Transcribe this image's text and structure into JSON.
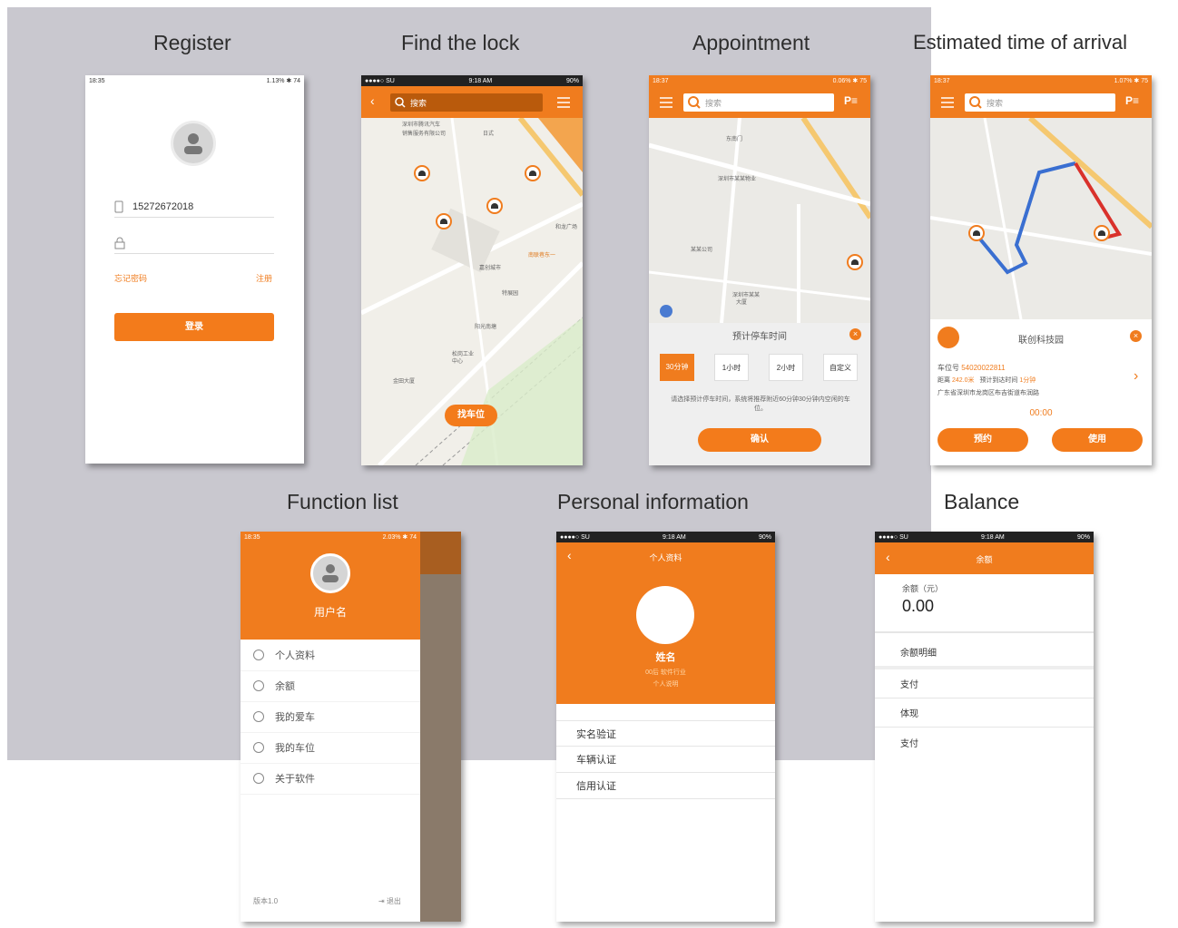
{
  "titles": {
    "register": "Register",
    "find_lock": "Find the lock",
    "appointment": "Appointment",
    "eta": "Estimated time of arrival",
    "function_list": "Function list",
    "personal_info": "Personal information",
    "balance": "Balance"
  },
  "register": {
    "status_time": "18:35",
    "status_right": "1.13% ✱ 74",
    "phone_value": "15272672018",
    "password_value": "",
    "forgot_label": "忘记密码",
    "register_link": "注册",
    "login_button": "登录"
  },
  "find_lock": {
    "status_left": "●●●●○ SU",
    "status_time": "9:18 AM",
    "status_right": "90%",
    "search_placeholder": "搜索",
    "find_button": "找车位",
    "map_labels": [
      "深圳市腾讯汽车",
      "销售服务有限公司",
      "日式",
      "和龙广场",
      "南联巷东一",
      "嘉创城市",
      "特展园",
      "阳光南塘",
      "松岗工业",
      "中心",
      "金田大厦"
    ]
  },
  "appointment": {
    "status_time": "18:37",
    "status_right": "0.06% ✱ 75",
    "search_placeholder": "搜索",
    "panel_title": "预计停车时间",
    "options": [
      "30分钟",
      "1小时",
      "2小时",
      "自定义"
    ],
    "hint": "请选择预计停车时间，系统将推荐附近60分钟30分钟内空闲的车位。",
    "confirm_button": "确认",
    "map_labels": [
      "东南门",
      "深圳市某某",
      "大厦",
      "深圳市某某物业",
      "某某公司"
    ]
  },
  "eta": {
    "status_time": "18:37",
    "status_right": "1.07% ✱ 75",
    "search_placeholder": "搜索",
    "place_name": "联创科技园",
    "spot_label": "车位号",
    "spot_number": "54020022811",
    "distance_label": "距离",
    "distance_value": "242.0米",
    "arrival_label": "预计到达时间",
    "arrival_value": "1分钟",
    "address": "广东省深圳市龙岗区布吉街道布润路",
    "timer": "00:00",
    "reserve_button": "预约",
    "use_button": "使用"
  },
  "function_list": {
    "status_time": "18:35",
    "status_right": "2.03% ✱ 74",
    "username": "用户名",
    "items": [
      {
        "label": "个人资料",
        "icon": "user-icon"
      },
      {
        "label": "余额",
        "icon": "wallet-icon"
      },
      {
        "label": "我的爱车",
        "icon": "car-icon"
      },
      {
        "label": "我的车位",
        "icon": "parking-icon"
      },
      {
        "label": "关于软件",
        "icon": "info-icon"
      }
    ],
    "version": "版本1.0",
    "logout": "退出"
  },
  "personal_info": {
    "status_left": "●●●●○ SU",
    "status_time": "9:18 AM",
    "status_right": "90%",
    "title": "个人资料",
    "name": "姓名",
    "sub1": "00后 软件行业",
    "sub2": "个人说明",
    "rows": [
      "实名验证",
      "车辆认证",
      "信用认证"
    ]
  },
  "balance": {
    "status_left": "●●●●○ SU",
    "status_time": "9:18 AM",
    "status_right": "90%",
    "title": "余额",
    "balance_label": "余额（元）",
    "balance_value": "0.00",
    "rows": [
      "余额明细",
      "支付",
      "体现",
      "支付"
    ]
  },
  "colors": {
    "accent": "#f07c1e",
    "panel_bg": "#c9c8cf",
    "route_blue": "#3a6fd1",
    "route_red": "#d9312b"
  }
}
